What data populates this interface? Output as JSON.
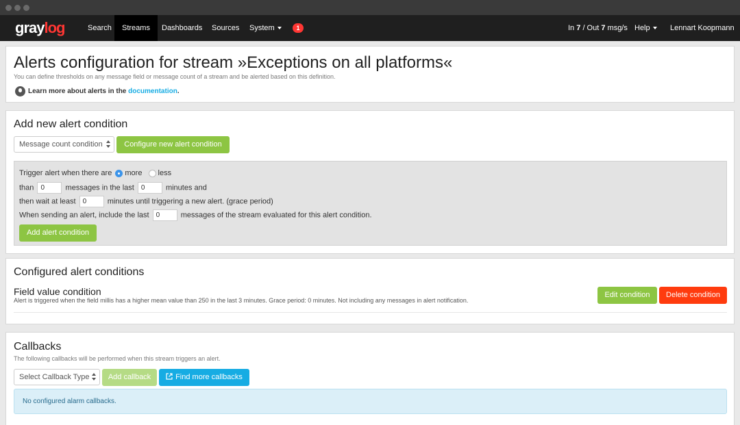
{
  "navbar": {
    "logo_gray": "gray",
    "logo_log": "log",
    "items": [
      "Search",
      "Streams",
      "Dashboards",
      "Sources",
      "System"
    ],
    "notification_count": "1",
    "throughput_in_label": "In",
    "throughput_in": "7",
    "throughput_out_label": "/ Out",
    "throughput_out": "7",
    "throughput_unit": "msg/s",
    "help": "Help",
    "user": "Lennart Koopmann"
  },
  "header": {
    "title": "Alerts configuration for stream »Exceptions on all platforms«",
    "description": "You can define thresholds on any message field or message count of a stream and be alerted based on this definition.",
    "learn_prefix": "Learn more about alerts in the",
    "learn_link": "documentation",
    "learn_suffix": "."
  },
  "add_condition": {
    "heading": "Add new alert condition",
    "type_select": "Message count condition",
    "configure_button": "Configure new alert condition",
    "form": {
      "trigger_label": "Trigger alert when there are",
      "option_more": "more",
      "option_less": "less",
      "than_label": "than",
      "count_value": "0",
      "messages_in_last_label": "messages in the last",
      "minutes_value": "0",
      "minutes_and_label": "minutes and",
      "wait_label": "then wait at least",
      "grace_value": "0",
      "grace_label": "minutes until triggering a new alert. (grace period)",
      "include_label": "When sending an alert, include the last",
      "include_value": "0",
      "include_suffix": "messages of the stream evaluated for this alert condition."
    },
    "add_button": "Add alert condition"
  },
  "configured": {
    "heading": "Configured alert conditions",
    "condition_title": "Field value condition",
    "condition_description": "Alert is triggered when the field millis has a higher mean value than 250 in the last 3 minutes. Grace period: 0 minutes. Not including any messages in alert notification.",
    "edit_button": "Edit condition",
    "delete_button": "Delete condition"
  },
  "callbacks": {
    "heading": "Callbacks",
    "description": "The following callbacks will be performed when this stream triggers an alert.",
    "type_select": "Select Callback Type",
    "add_button": "Add callback",
    "find_more_button": "Find more callbacks",
    "empty_message": "No configured alarm callbacks."
  },
  "colors": {
    "navbar_bg": "#1f1f1f",
    "brand_red": "#ff3633",
    "success_green": "#8dc543",
    "danger_red": "#ff3b0e",
    "info_blue": "#16ace3"
  }
}
